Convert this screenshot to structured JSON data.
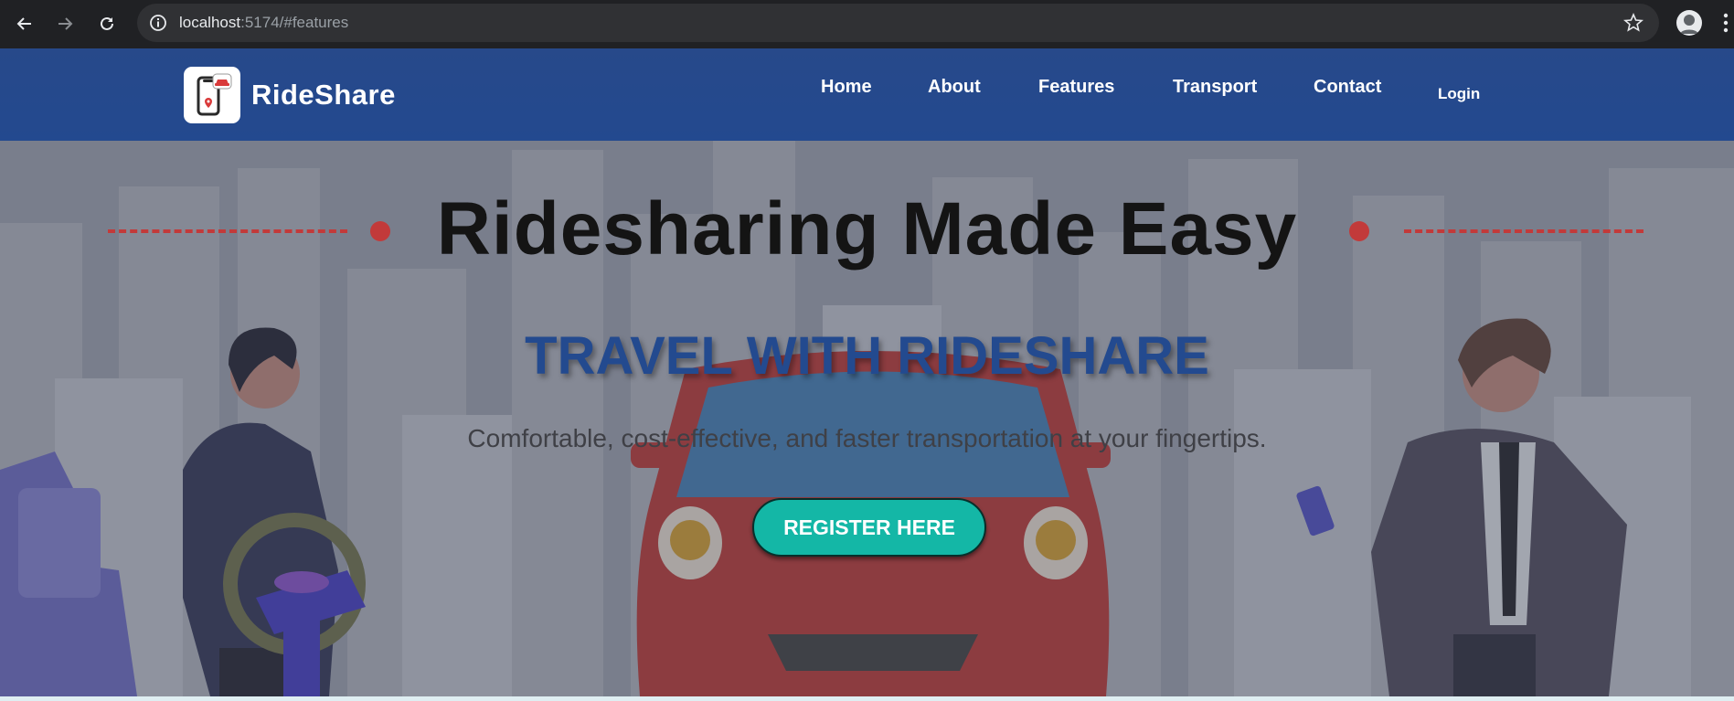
{
  "browser": {
    "url_host": "localhost",
    "url_rest": ":5174/#features",
    "icons": {
      "back": "arrow-left-icon",
      "forward": "arrow-right-icon",
      "reload": "reload-icon",
      "info": "info-icon",
      "bookmark": "star-icon",
      "profile": "profile-avatar-icon",
      "menu": "kebab-menu-icon"
    }
  },
  "header": {
    "brand": "RideShare",
    "logo_icon": "phone-car-pin-icon",
    "nav": [
      "Home",
      "About",
      "Features",
      "Transport",
      "Contact"
    ],
    "login": "Login"
  },
  "hero": {
    "title": "Ridesharing Made Easy",
    "subtitle": "TRAVEL WITH RIDESHARE",
    "tagline": "Comfortable, cost-effective, and faster transportation at your fingertips.",
    "cta": "REGISTER HERE"
  },
  "colors": {
    "header_bg": "#27498a",
    "accent_red": "#c23a3a",
    "subtitle_blue": "#234a8f",
    "cta_teal": "#14b7a6"
  }
}
